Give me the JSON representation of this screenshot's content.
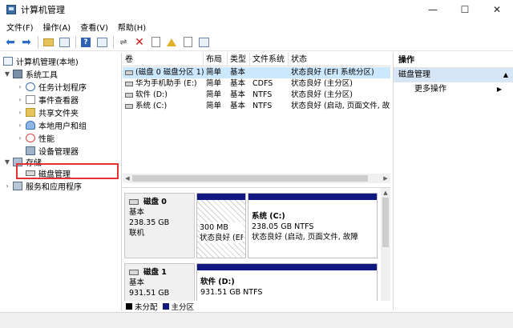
{
  "window": {
    "title": "计算机管理",
    "controls": {
      "minimize": "—",
      "maximize": "☐",
      "close": "✕"
    }
  },
  "menu": [
    "文件(F)",
    "操作(A)",
    "查看(V)",
    "帮助(H)"
  ],
  "toolbar": {
    "icons": [
      "back-arrow-icon",
      "forward-arrow-icon",
      "up-folder-icon",
      "show-hide-tree-icon",
      "help-icon",
      "properties-icon",
      "connect-icon",
      "delete-icon",
      "check-icon",
      "folder-up-icon",
      "document-icon",
      "list-view-icon"
    ]
  },
  "tree": {
    "root": "计算机管理(本地)",
    "system_tools": "系统工具",
    "items": [
      "任务计划程序",
      "事件查看器",
      "共享文件夹",
      "本地用户和组",
      "性能",
      "设备管理器"
    ],
    "storage": "存储",
    "disk_management": "磁盘管理",
    "services": "服务和应用程序"
  },
  "volumes": {
    "headers": [
      "卷",
      "布局",
      "类型",
      "文件系统",
      "状态"
    ],
    "rows": [
      {
        "name": "(磁盘 0 磁盘分区 1)",
        "layout": "简单",
        "type": "基本",
        "fs": "",
        "status": "状态良好 (EFI 系统分区)"
      },
      {
        "name": "华为手机助手 (E:)",
        "layout": "简单",
        "type": "基本",
        "fs": "CDFS",
        "status": "状态良好 (主分区)"
      },
      {
        "name": "软件 (D:)",
        "layout": "简单",
        "type": "基本",
        "fs": "NTFS",
        "status": "状态良好 (主分区)"
      },
      {
        "name": "系统 (C:)",
        "layout": "简单",
        "type": "基本",
        "fs": "NTFS",
        "status": "状态良好 (启动, 页面文件, 故"
      }
    ]
  },
  "disks": [
    {
      "name": "磁盘 0",
      "kind": "基本",
      "size": "238.35 GB",
      "state": "联机",
      "partitions": [
        {
          "size": "300 MB",
          "status": "状态良好 (EF"
        },
        {
          "label": "系统 (C:)",
          "size": "238.05 GB NTFS",
          "status": "状态良好 (启动, 页面文件, 故障"
        }
      ]
    },
    {
      "name": "磁盘 1",
      "kind": "基本",
      "size": "931.51 GB",
      "partitions": [
        {
          "label": "软件 (D:)",
          "size": "931.51 GB NTFS"
        }
      ]
    }
  ],
  "legend": {
    "unallocated": "未分配",
    "primary": "主分区"
  },
  "actions": {
    "header": "操作",
    "section": "磁盘管理",
    "more": "更多操作"
  },
  "colors": {
    "primary_partition": "#131880",
    "selection": "#cce8ff",
    "highlight_box": "#e23232"
  }
}
